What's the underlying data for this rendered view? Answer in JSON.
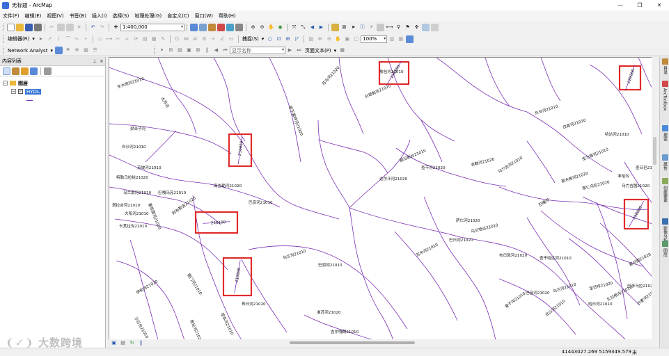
{
  "window": {
    "title": "无标题 - ArcMap",
    "controls": [
      "—",
      "❐",
      "✕"
    ]
  },
  "menubar": {
    "items": [
      "文件(F)",
      "编辑(E)",
      "视图(V)",
      "书签(B)",
      "插入(I)",
      "选择(S)",
      "地理处理(G)",
      "自定义(C)",
      "窗口(W)",
      "帮助(H)"
    ]
  },
  "toolbar1": {
    "scale": "1:400,000"
  },
  "toolbar2": {
    "editor_label": "编辑器(R)",
    "snapping_label": "捕捉(S)",
    "zoom_percent": "100%"
  },
  "toolbar3": {
    "network_analyst_label": "Network Analyst",
    "display_name_placeholder": "显示名称",
    "page_text_label": "页面文本(P)"
  },
  "toc": {
    "title": "内容列表",
    "root_layer": "图层",
    "layer": "HYDL"
  },
  "right_dock": {
    "tabs": [
      {
        "label": "目录",
        "icon": "catalog-icon"
      },
      {
        "label": "ArcToolbox",
        "icon": "toolbox-icon"
      },
      {
        "label": "搜索",
        "icon": "search-icon"
      },
      {
        "label": "属性",
        "icon": "properties-icon"
      },
      {
        "label": "创建要素",
        "icon": "create-features-icon"
      },
      {
        "label": "影像分析",
        "icon": "image-analysis-icon"
      },
      {
        "label": "图层",
        "icon": "layers-icon"
      }
    ]
  },
  "map": {
    "line_color": "#7b2fb5",
    "highlight_color": "#e02a2a",
    "labels": [
      "东大阳河21010",
      "大苏河",
      "梁台子河",
      "白沙河21010",
      "苏坡河21010",
      "特勒乌拉给21020",
      "乌兰那河21010",
      "康苏图河21010",
      "塔拉吉河21010",
      "大阳河21010",
      "阿布勒吉21020",
      "卡其拉沟21010",
      "巴嘎乌苏21010",
      "高吉勒河21020",
      "巴彦河21010",
      "查干套特河21020",
      "苏乌河21020",
      "白塔勒吉21020",
      "敖包河21010",
      "额日斯台21010",
      "达尔汗河21020",
      "查干河21020",
      "吉勒河21020",
      "乌力吉河21010",
      "那木根河21020",
      "宝力格河21010",
      "哈达河21010",
      "准哈沟",
      "查日巴21020",
      "巴嘎河",
      "那仁乌拉21020",
      "东乌河21010",
      "白音河21010",
      "乌力吉图21020",
      "苏木河21010",
      "萨仁河21020",
      "乌兰哈达21010",
      "布日敦河21020",
      "查干哈达河21010",
      "巴音河21020",
      "乌兰河21010",
      "查干沟21010",
      "北山河21010",
      "哈日河21010",
      "宝日呼21020",
      "扎拉格沟21010",
      "那日图21020",
      "沙麦河21010",
      "巴彦乌拉21020",
      "图门河21010",
      "伊和河21020",
      "沙日台21010",
      "敖伦河21020",
      "塔本河21010",
      "珠日河21020",
      "乌兰沟21010",
      "巴润河21010",
      "准苏河21020",
      "吉尔嘎朗21010",
      "巴日河21020"
    ],
    "highlight_labels": [
      "210100",
      "220100",
      "210020",
      "210100",
      "210200",
      "210200"
    ]
  },
  "statusbar": {
    "coordinates": "41443027.269  5159349.579",
    "units": "米"
  },
  "watermark": "大数跨境"
}
